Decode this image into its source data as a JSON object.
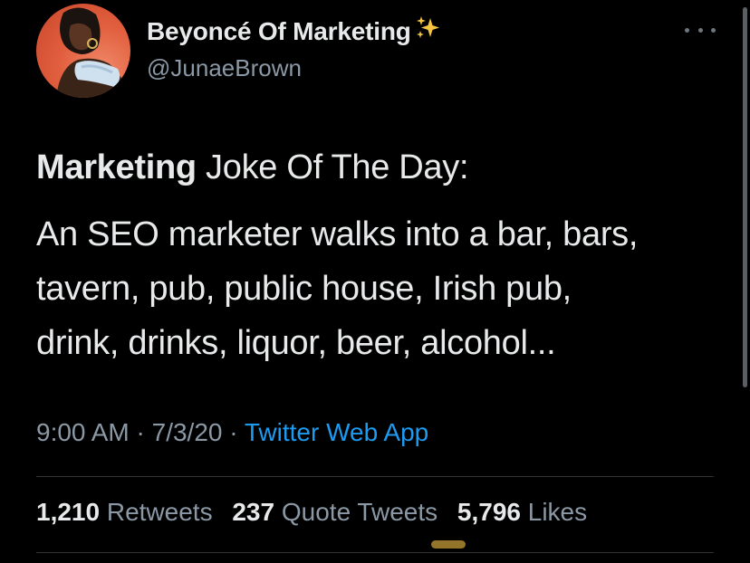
{
  "tweet": {
    "author": {
      "display_name": "Beyoncé Of Marketing",
      "emoji": "sparkles-icon",
      "handle": "@JunaeBrown"
    },
    "text": {
      "title_bold": "Marketing",
      "title_rest": " Joke Of The Day:",
      "body_lines": [
        "An SEO marketer walks into a bar, bars,",
        "tavern, pub, public house, Irish pub,",
        "drink, drinks, liquor, beer, alcohol..."
      ]
    },
    "meta": {
      "time": "9:00 AM",
      "separator": " · ",
      "date": "7/3/20",
      "source": "Twitter Web App"
    },
    "stats": {
      "retweets_count": "1,210",
      "retweets_label": "Retweets",
      "quotes_count": "237",
      "quotes_label": "Quote Tweets",
      "likes_count": "5,796",
      "likes_label": "Likes"
    }
  },
  "colors": {
    "background": "#000000",
    "primary_text": "#e7e9ea",
    "secondary_text": "#8b98a5",
    "link": "#1d9bf0",
    "divider": "#2f3336"
  }
}
